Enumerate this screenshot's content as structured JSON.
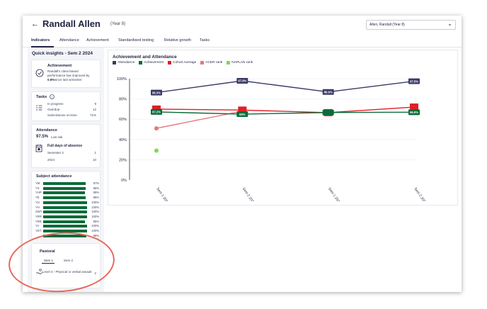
{
  "header": {
    "back_icon": "back-arrow-icon",
    "student_name": "Randall Allen",
    "year": "(Year 8)",
    "student_select": "Allen, Randall (Year 8)"
  },
  "tabs": [
    {
      "label": "Indicators",
      "active": true
    },
    {
      "label": "Attendance"
    },
    {
      "label": "Achievement"
    },
    {
      "label": "Standardised testing"
    },
    {
      "label": "Relative growth"
    },
    {
      "label": "Tasks"
    }
  ],
  "quick_insights": {
    "title": "Quick insights - Sem 2 2024",
    "achievement": {
      "title": "Achievement",
      "line1": "Randall's class-based",
      "line2": "performance has improved by",
      "highlight": "0.6%",
      "line3": "since last semester"
    },
    "tasks": {
      "title": "Tasks",
      "rows": [
        {
          "label": "In progress",
          "value": "9"
        },
        {
          "label": "Overdue",
          "value": "12"
        },
        {
          "label": "Submissions on-time",
          "value": "71%"
        }
      ]
    },
    "attendance": {
      "title": "Attendance",
      "rate": "97.5%",
      "risk": "Low risk",
      "absence_title": "Full days of absence",
      "rows": [
        {
          "label": "Semester 2",
          "value": "1"
        },
        {
          "label": "2024",
          "value": "10"
        }
      ]
    },
    "subject_attendance": {
      "title": "Subject attendance",
      "rows": [
        {
          "label": "YM",
          "pct": "97%",
          "value": 97
        },
        {
          "label": "YS",
          "pct": "96%",
          "value": 96
        },
        {
          "label": "YHP",
          "pct": "95%",
          "value": 95
        },
        {
          "label": "YE",
          "pct": "96%",
          "value": 96
        },
        {
          "label": "YLI",
          "pct": "100%",
          "value": 100
        },
        {
          "label": "YH",
          "pct": "100%",
          "value": 100
        },
        {
          "label": "SWY",
          "pct": "100%",
          "value": 100
        },
        {
          "label": "YRR",
          "pct": "100%",
          "value": 100
        },
        {
          "label": "YRE",
          "pct": "95%",
          "value": 95
        },
        {
          "label": "YA",
          "pct": "100%",
          "value": 100
        },
        {
          "label": "YDT",
          "pct": "100%",
          "value": 100
        },
        {
          "label": "",
          "pct": "98%",
          "value": 98
        }
      ]
    },
    "pastoral": {
      "title": "Pastoral",
      "tabs": [
        "Sem 1",
        "Sem 2"
      ],
      "active_tab": 0,
      "incident": "Level 3 - Physical or verbal assault",
      "incident_count": "2"
    }
  },
  "chart_data": {
    "type": "line",
    "title": "Achievement and Attendance",
    "xlabel": "",
    "ylabel": "",
    "categories": [
      "Sem 1 2023",
      "Sem 2 2023",
      "Sem 1 2024",
      "Sem 2 2024"
    ],
    "ylim": [
      0,
      100
    ],
    "yticks": [
      "100%",
      "80%",
      "60%",
      "40%",
      "20%",
      "0%"
    ],
    "legend": "top-left",
    "series": [
      {
        "name": "Attendance",
        "color": "#3b3a66",
        "values": [
          86.3,
          97.9,
          86.9,
          97.5
        ],
        "labels": [
          "86.3%",
          "97.9%",
          "86.9%",
          "97.5%"
        ]
      },
      {
        "name": "Achievement",
        "color": "#0b6b3a",
        "values": [
          67.2,
          65,
          66.6,
          66.9
        ],
        "labels": [
          "67.2%",
          "65%",
          "",
          "66.9%"
        ]
      },
      {
        "name": "Cohort Average",
        "color": "#e01f26",
        "values": [
          70,
          69,
          66.5,
          72
        ]
      },
      {
        "name": "ACER rank",
        "color": "#e8777a",
        "values": [
          51,
          68,
          null,
          null
        ]
      },
      {
        "name": "NAPLAN rank",
        "color": "#7ed957",
        "values": [
          29,
          null,
          null,
          null
        ]
      }
    ]
  }
}
